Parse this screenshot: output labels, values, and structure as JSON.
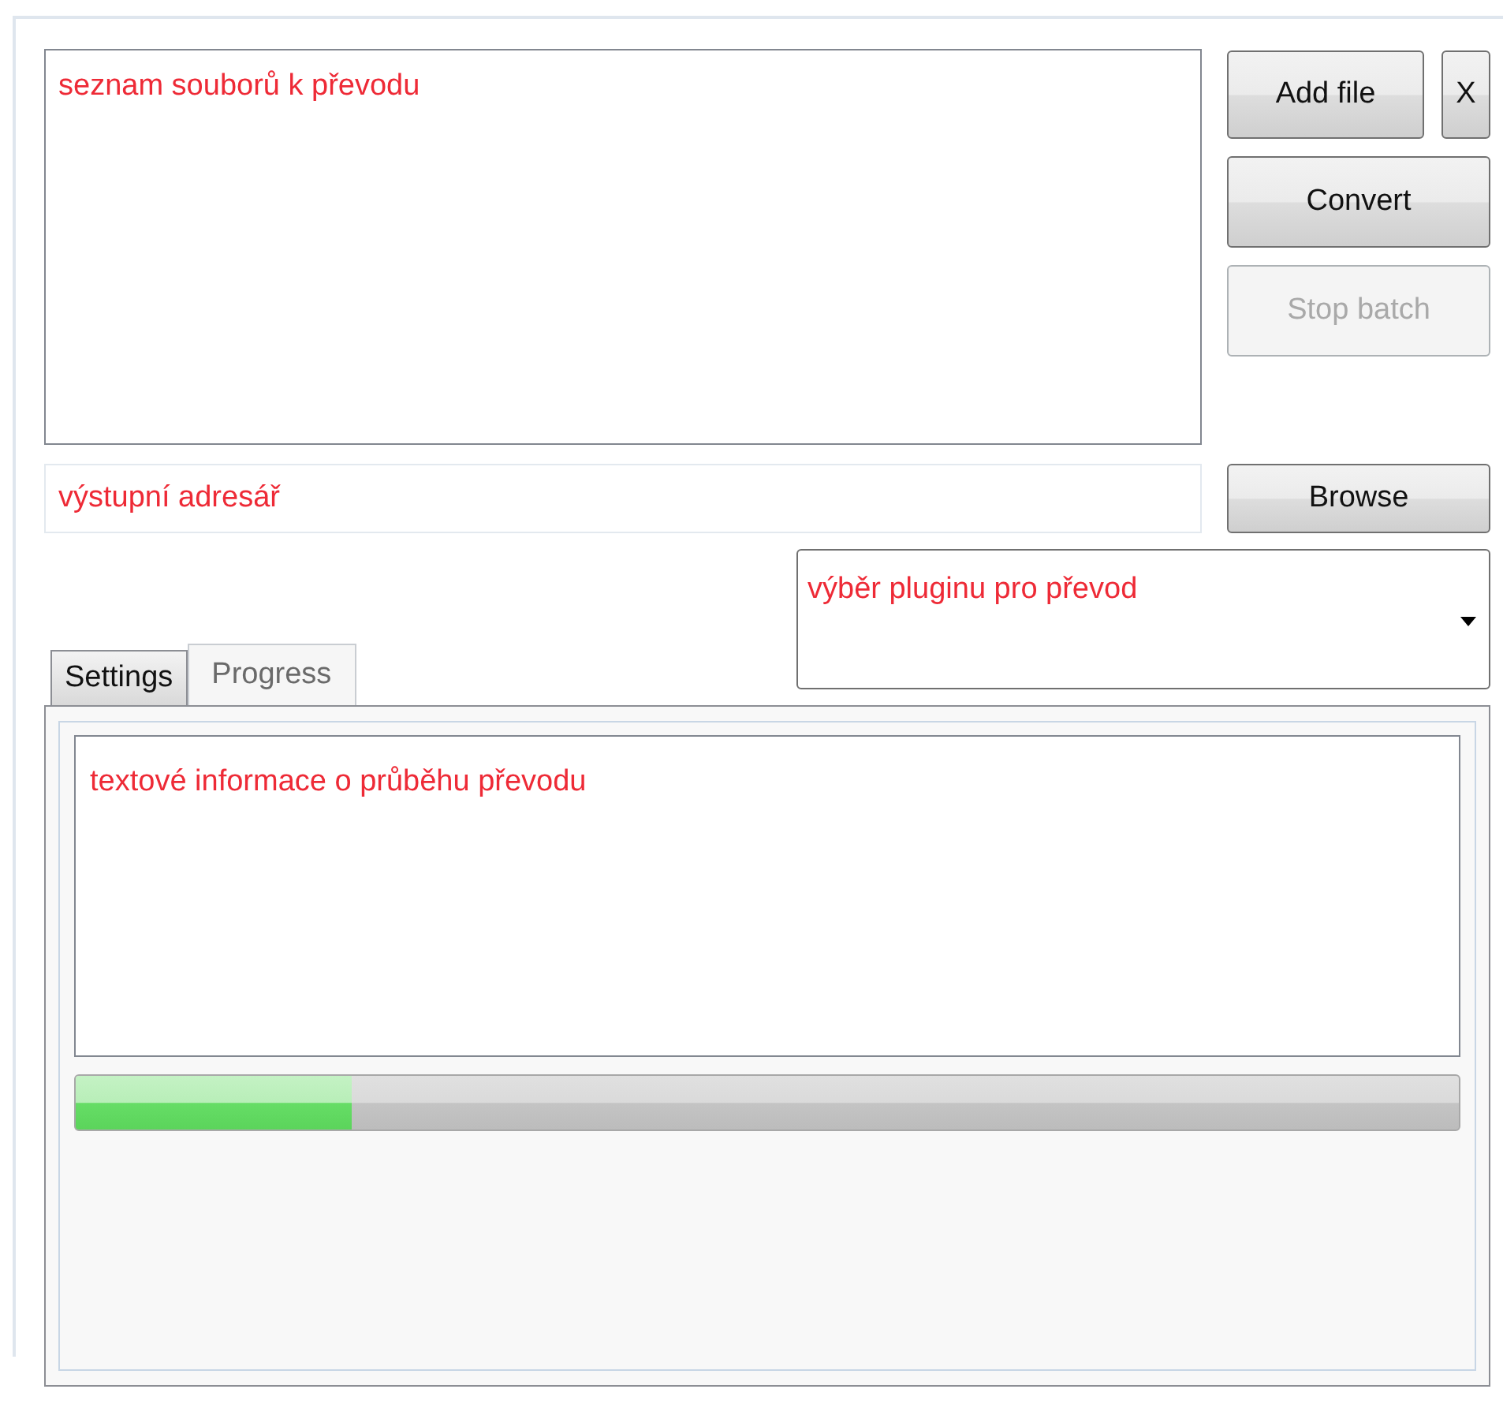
{
  "file_list": {
    "text": "seznam souborů k převodu"
  },
  "buttons": [
    {
      "label": "Add file",
      "kind": "add",
      "disabled": false
    },
    {
      "label": "X",
      "kind": "remove",
      "disabled": false
    },
    {
      "label": "Convert",
      "kind": "convert",
      "disabled": false
    },
    {
      "label": "Stop batch",
      "kind": "stop",
      "disabled": true
    }
  ],
  "output_dir": {
    "value": "výstupní adresář"
  },
  "browse_button": {
    "label": "Browse"
  },
  "plugin_select": {
    "value": "výběr pluginu pro převod"
  },
  "tabs": [
    {
      "label": "Settings",
      "selected": false
    },
    {
      "label": "Progress",
      "selected": true
    }
  ],
  "log": {
    "text": "textové informace o průběhu převodu"
  },
  "progress": {
    "level": 0.2
  }
}
